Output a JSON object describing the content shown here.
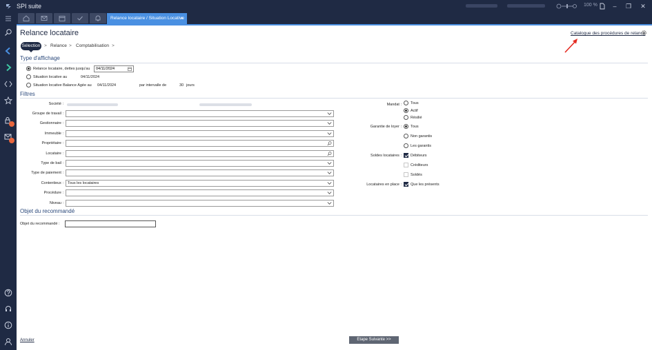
{
  "app": {
    "title": "SPI suite",
    "zoom": "100 %"
  },
  "tabs": {
    "active_label": "Relance locataire / Situation Locative",
    "close": "×"
  },
  "page": {
    "title": "Relance locataire",
    "catalogue_link": "Catalogue des procédures de relance"
  },
  "steps": {
    "active": "Sélection",
    "items": [
      "Relance",
      "Comptabilisation"
    ],
    "separator": ">"
  },
  "affichage": {
    "title": "Type d'affichage",
    "opt1_label": "Relance locataire, dettes jusqu'au",
    "opt1_date": "04/11/2024",
    "opt2_label": "Situation locative au",
    "opt2_date": "04/11/2024",
    "opt3_label": "Situation locative Balance Agée au",
    "opt3_date": "04/11/2024",
    "interval_label": "par intervalle de",
    "interval_value": "30",
    "interval_unit": "jours"
  },
  "filtres": {
    "title": "Filtres",
    "societe_label": "Société :",
    "fields": [
      {
        "label": "Groupe de travail :",
        "value": ""
      },
      {
        "label": "Gestionnaire :",
        "value": ""
      },
      {
        "label": "Immeuble :",
        "value": ""
      },
      {
        "label": "Propriétaire :",
        "value": ""
      },
      {
        "label": "Locataire :",
        "value": ""
      },
      {
        "label": "Type de bail :",
        "value": ""
      },
      {
        "label": "Type de paiement :",
        "value": ""
      },
      {
        "label": "Contentieux :",
        "value": "Tous les locataires"
      },
      {
        "label": "Procédure :",
        "value": ""
      },
      {
        "label": "Niveau :",
        "value": ""
      }
    ],
    "mandat": {
      "label": "Mandat :",
      "options": [
        "Tous",
        "Actif",
        "Résilié"
      ]
    },
    "garantie": {
      "label": "Garantie de loyer :",
      "options": [
        "Tous",
        "Non garantis",
        "Les garantis"
      ]
    },
    "soldes": {
      "label": "Soldes locataires :",
      "options": [
        "Débiteurs",
        "Créditeurs",
        "Soldés"
      ]
    },
    "en_place": {
      "label": "Locataires en place :",
      "option": "Que les présents"
    }
  },
  "objet": {
    "title": "Objet du recommandé",
    "label": "Objet du recommandé :",
    "value": ""
  },
  "footer": {
    "cancel": "Annuler",
    "next": "Etape Suivante >>"
  },
  "colors": {
    "accent": "#4a90e2",
    "navy": "#1f2a44",
    "badge": "#e8663d"
  }
}
